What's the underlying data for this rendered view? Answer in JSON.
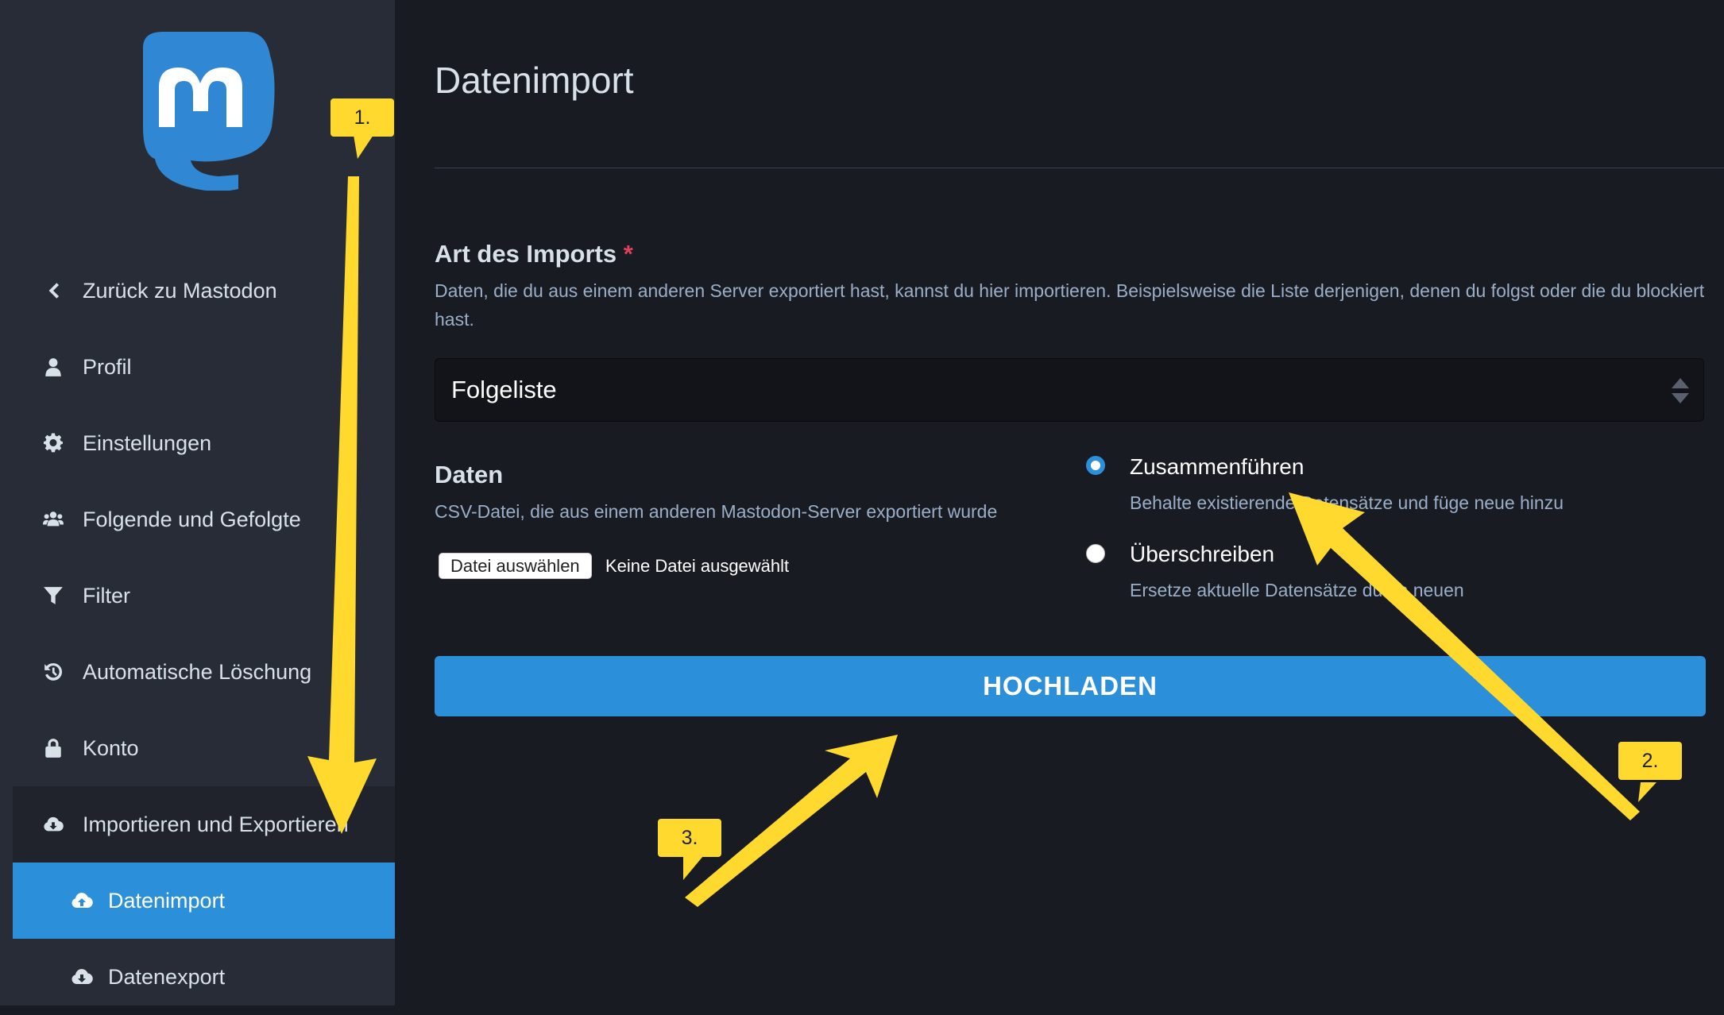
{
  "sidebar": {
    "items": [
      {
        "label": "Zurück zu Mastodon",
        "icon": "chevron-left-icon"
      },
      {
        "label": "Profil",
        "icon": "user-icon"
      },
      {
        "label": "Einstellungen",
        "icon": "gear-icon"
      },
      {
        "label": "Folgende und Gefolgte",
        "icon": "users-icon"
      },
      {
        "label": "Filter",
        "icon": "filter-icon"
      },
      {
        "label": "Automatische Löschung",
        "icon": "history-icon"
      },
      {
        "label": "Konto",
        "icon": "lock-icon"
      },
      {
        "label": "Importieren und Exportieren",
        "icon": "cloud-download-icon"
      }
    ],
    "subitems": [
      {
        "label": "Datenimport",
        "icon": "cloud-upload-icon",
        "active": true
      },
      {
        "label": "Datenexport",
        "icon": "cloud-download-icon",
        "active": false
      }
    ]
  },
  "main": {
    "title": "Datenimport",
    "import_type": {
      "label": "Art des Imports",
      "required_mark": "*",
      "hint": "Daten, die du aus einem anderen Server exportiert hast, kannst du hier importieren. Beispielsweise die Liste derjenigen, denen du folgst oder die du blockiert hast.",
      "selected": "Folgeliste"
    },
    "data": {
      "label": "Daten",
      "hint": "CSV-Datei, die aus einem anderen Mastodon-Server exportiert wurde",
      "file_button": "Datei auswählen",
      "file_status": "Keine Datei ausgewählt"
    },
    "mode": {
      "options": [
        {
          "label": "Zusammenführen",
          "hint": "Behalte existierende Datensätze und füge neue hinzu",
          "selected": true
        },
        {
          "label": "Überschreiben",
          "hint": "Ersetze aktuelle Datensätze durch neuen",
          "selected": false
        }
      ]
    },
    "submit_label": "HOCHLADEN"
  },
  "annotations": {
    "step1": "1.",
    "step2": "2.",
    "step3": "3.",
    "color": "#ffd92e"
  },
  "colors": {
    "accent": "#2b90d9",
    "sidebar_bg": "#282c37",
    "main_bg": "#191b22",
    "required": "#df405a"
  }
}
